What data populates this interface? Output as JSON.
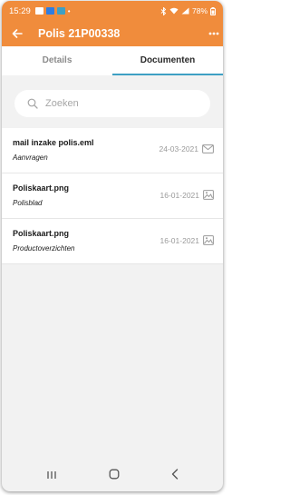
{
  "status_bar": {
    "time": "15:29",
    "battery": "78%"
  },
  "app_bar": {
    "title": "Polis 21P00338"
  },
  "tabs": [
    {
      "label": "Details",
      "active": false
    },
    {
      "label": "Documenten",
      "active": true
    }
  ],
  "search": {
    "placeholder": "Zoeken"
  },
  "documents": [
    {
      "name": "mail inzake polis.eml",
      "category": "Aanvragen",
      "date": "24-03-2021",
      "icon": "mail-icon"
    },
    {
      "name": "Poliskaart.png",
      "category": "Polisblad",
      "date": "16-01-2021",
      "icon": "image-icon"
    },
    {
      "name": "Poliskaart.png",
      "category": "Productoverzichten",
      "date": "16-01-2021",
      "icon": "image-icon"
    }
  ],
  "colors": {
    "accent": "#f08c3c",
    "tab_indicator": "#3ea0c4",
    "background": "#f2f2f2"
  }
}
